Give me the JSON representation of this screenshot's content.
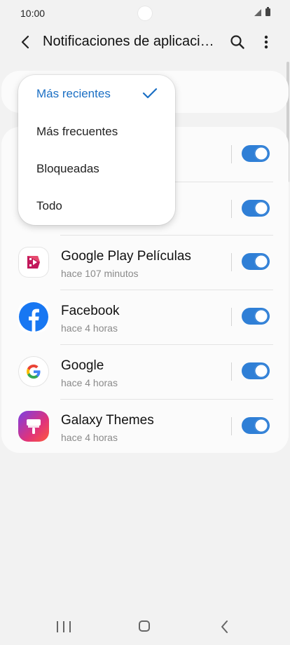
{
  "status": {
    "time": "10:00"
  },
  "appbar": {
    "title": "Notificaciones de aplicaciones"
  },
  "filter_menu": {
    "items": [
      {
        "label": "Más recientes",
        "selected": true
      },
      {
        "label": "Más frecuentes",
        "selected": false
      },
      {
        "label": "Bloqueadas",
        "selected": false
      },
      {
        "label": "Todo",
        "selected": false
      }
    ]
  },
  "apps": [
    {
      "name": "",
      "time": "",
      "enabled": true
    },
    {
      "name": "",
      "time": "",
      "enabled": true
    },
    {
      "name": "Google Play Películas",
      "time": "hace 107 minutos",
      "icon": "google-play-movies-icon",
      "enabled": true
    },
    {
      "name": "Facebook",
      "time": "hace 4 horas",
      "icon": "facebook-icon",
      "enabled": true
    },
    {
      "name": "Google",
      "time": "hace 4 horas",
      "icon": "google-icon",
      "enabled": true
    },
    {
      "name": "Galaxy Themes",
      "time": "hace 4 horas",
      "icon": "galaxy-themes-icon",
      "enabled": true
    }
  ],
  "colors": {
    "accent": "#2f7fd6",
    "selected_text": "#1b6fc4"
  }
}
